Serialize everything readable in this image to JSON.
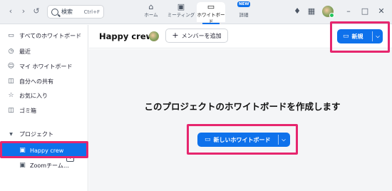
{
  "topbar": {
    "search_placeholder": "検索",
    "search_shortcut": "Ctrl+F",
    "tabs": [
      {
        "label": "ホーム",
        "icon": "home-icon"
      },
      {
        "label": "ミーティング",
        "icon": "video-icon"
      },
      {
        "label": "ホワイトボード",
        "icon": "whiteboard-icon"
      },
      {
        "label": "詳細",
        "icon": "more-icon"
      }
    ],
    "new_badge": "NEW",
    "active_tab": "ホワイトボード"
  },
  "sidebar": {
    "items": [
      {
        "label": "すべてのホワイトボード",
        "icon": "whiteboard-icon"
      },
      {
        "label": "最近",
        "icon": "clock-icon"
      },
      {
        "label": "マイ ホワイトボード",
        "icon": "person-icon"
      },
      {
        "label": "自分への共有",
        "icon": "share-icon"
      },
      {
        "label": "お気に入り",
        "icon": "star-icon"
      },
      {
        "label": "ゴミ箱",
        "icon": "trash-icon"
      }
    ],
    "projects_label": "プロジェクト",
    "projects": [
      {
        "label": "Happy crew",
        "selected": true
      },
      {
        "label": "Zoomチーム…",
        "selected": false
      }
    ]
  },
  "main": {
    "project_title": "Happy crew",
    "add_member_label": "メンバーを追加",
    "new_button_label": "新規",
    "empty_headline": "このプロジェクトのホワイトボードを作成します",
    "new_whiteboard_button_label": "新しいホワイトボード"
  },
  "colors": {
    "accent": "#0e71eb",
    "highlight": "#e6266e"
  }
}
